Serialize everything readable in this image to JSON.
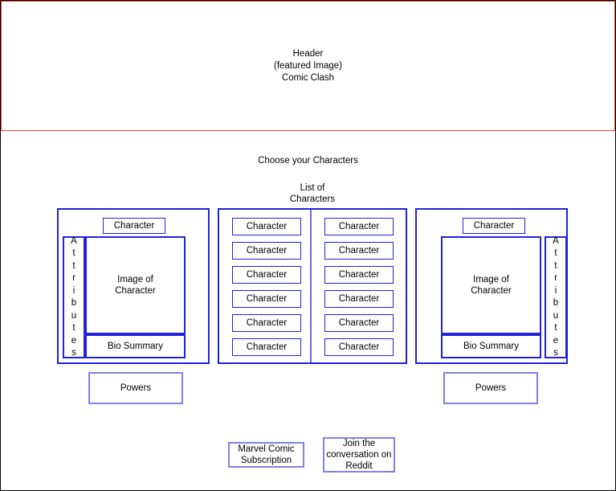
{
  "header": {
    "line1": "Header",
    "line2": "(featured Image)",
    "line3": "Comic Clash",
    "border_color": "#e8453c"
  },
  "main": {
    "choose_heading": "Choose your Characters",
    "list_heading_line1": "List of",
    "list_heading_line2": "Characters"
  },
  "left_card": {
    "character_tag": "Character",
    "attributes_label": "Attributes",
    "image_line1": "Image of",
    "image_line2": "Character",
    "bio_summary": "Bio Summary",
    "powers": "Powers"
  },
  "right_card": {
    "character_tag": "Character",
    "attributes_label": "Attributes",
    "image_line1": "Image of",
    "image_line2": "Character",
    "bio_summary": "Bio Summary",
    "powers": "Powers"
  },
  "character_list": {
    "column_a": [
      "Character",
      "Character",
      "Character",
      "Character",
      "Character",
      "Character"
    ],
    "column_b": [
      "Character",
      "Character",
      "Character",
      "Character",
      "Character",
      "Character"
    ]
  },
  "footer": {
    "subscription_line1": "Marvel Comic",
    "subscription_line2": "Subscription",
    "reddit_line1": "Join the",
    "reddit_line2": "conversation on",
    "reddit_line3": "Reddit"
  },
  "colors": {
    "accent_blue": "#2222dd",
    "light_blue": "#8080f0",
    "header_red": "#e8453c",
    "page_border": "#000000"
  }
}
